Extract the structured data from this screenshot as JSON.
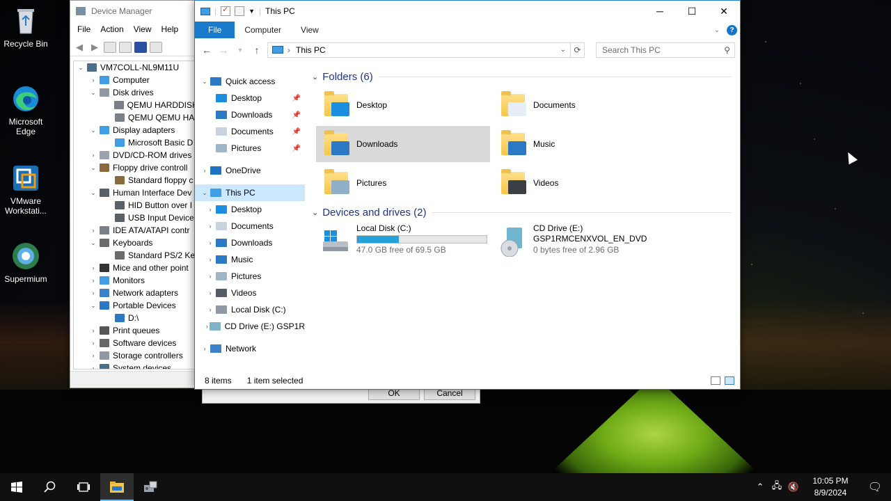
{
  "desktop": {
    "icons": [
      {
        "label": "Recycle Bin"
      },
      {
        "label": "Microsoft Edge"
      },
      {
        "label": "VMware Workstati..."
      },
      {
        "label": "Supermium"
      }
    ]
  },
  "device_manager": {
    "title": "Device Manager",
    "menu": [
      "File",
      "Action",
      "View",
      "Help"
    ],
    "tree": [
      {
        "label": "VM7COLL-NL9M11U",
        "chev": "v",
        "indent": 0
      },
      {
        "label": "Computer",
        "chev": ">",
        "indent": 1
      },
      {
        "label": "Disk drives",
        "chev": "v",
        "indent": 1
      },
      {
        "label": "QEMU HARDDISK",
        "chev": "",
        "indent": 2
      },
      {
        "label": "QEMU QEMU HA",
        "chev": "",
        "indent": 2
      },
      {
        "label": "Display adapters",
        "chev": "v",
        "indent": 1
      },
      {
        "label": "Microsoft Basic D",
        "chev": "",
        "indent": 2
      },
      {
        "label": "DVD/CD-ROM drives",
        "chev": ">",
        "indent": 1
      },
      {
        "label": "Floppy drive controll",
        "chev": "v",
        "indent": 1
      },
      {
        "label": "Standard floppy c",
        "chev": "",
        "indent": 2
      },
      {
        "label": "Human Interface Dev",
        "chev": "v",
        "indent": 1
      },
      {
        "label": "HID Button over I",
        "chev": "",
        "indent": 2
      },
      {
        "label": "USB Input Device",
        "chev": "",
        "indent": 2
      },
      {
        "label": "IDE ATA/ATAPI contr",
        "chev": ">",
        "indent": 1
      },
      {
        "label": "Keyboards",
        "chev": "v",
        "indent": 1
      },
      {
        "label": "Standard PS/2 Ke",
        "chev": "",
        "indent": 2
      },
      {
        "label": "Mice and other point",
        "chev": ">",
        "indent": 1
      },
      {
        "label": "Monitors",
        "chev": ">",
        "indent": 1
      },
      {
        "label": "Network adapters",
        "chev": ">",
        "indent": 1
      },
      {
        "label": "Portable Devices",
        "chev": "v",
        "indent": 1
      },
      {
        "label": "D:\\",
        "chev": "",
        "indent": 2
      },
      {
        "label": "Print queues",
        "chev": ">",
        "indent": 1
      },
      {
        "label": "Software devices",
        "chev": ">",
        "indent": 1
      },
      {
        "label": "Storage controllers",
        "chev": ">",
        "indent": 1
      },
      {
        "label": "System devices",
        "chev": ">",
        "indent": 1
      }
    ]
  },
  "dialog": {
    "ok_label": "OK",
    "cancel_label": "Cancel"
  },
  "explorer": {
    "title": "This PC",
    "ribbon_tabs": [
      "File",
      "Computer",
      "View"
    ],
    "help_glyph": "?",
    "address": "This PC",
    "search_placeholder": "Search This PC",
    "nav": [
      {
        "label": "Quick access",
        "chev": "v",
        "indent": 0,
        "pin": false,
        "color": "#2b78c5"
      },
      {
        "label": "Desktop",
        "chev": "",
        "indent": 1,
        "pin": true,
        "color": "#1c8ee0"
      },
      {
        "label": "Downloads",
        "chev": "",
        "indent": 1,
        "pin": true,
        "color": "#2b78c5"
      },
      {
        "label": "Documents",
        "chev": "",
        "indent": 1,
        "pin": true,
        "color": "#c9d3de"
      },
      {
        "label": "Pictures",
        "chev": "",
        "indent": 1,
        "pin": true,
        "color": "#9fb6c9"
      },
      {
        "label": "OneDrive",
        "chev": ">",
        "indent": 0,
        "pin": false,
        "color": "#1e73c2"
      },
      {
        "label": "This PC",
        "chev": "v",
        "indent": 0,
        "pin": false,
        "color": "#3f9ee6",
        "selected": true
      },
      {
        "label": "Desktop",
        "chev": ">",
        "indent": 1,
        "pin": false,
        "color": "#1c8ee0"
      },
      {
        "label": "Documents",
        "chev": ">",
        "indent": 1,
        "pin": false,
        "color": "#c9d3de"
      },
      {
        "label": "Downloads",
        "chev": ">",
        "indent": 1,
        "pin": false,
        "color": "#2b78c5"
      },
      {
        "label": "Music",
        "chev": ">",
        "indent": 1,
        "pin": false,
        "color": "#2b78c5"
      },
      {
        "label": "Pictures",
        "chev": ">",
        "indent": 1,
        "pin": false,
        "color": "#9fb6c9"
      },
      {
        "label": "Videos",
        "chev": ">",
        "indent": 1,
        "pin": false,
        "color": "#555b66"
      },
      {
        "label": "Local Disk (C:)",
        "chev": ">",
        "indent": 1,
        "pin": false,
        "color": "#8f98a3"
      },
      {
        "label": "CD Drive (E:) GSP1R",
        "chev": ">",
        "indent": 1,
        "pin": false,
        "color": "#7fb3c8"
      },
      {
        "label": "Network",
        "chev": ">",
        "indent": 0,
        "pin": false,
        "color": "#3c82c9"
      }
    ],
    "folders_header": "Folders (6)",
    "folders": [
      {
        "label": "Desktop",
        "overlay": "#1c8ee0"
      },
      {
        "label": "Documents",
        "overlay": "#e8eef5"
      },
      {
        "label": "Downloads",
        "overlay": "#2b78c5",
        "selected": true
      },
      {
        "label": "Music",
        "overlay": "#2b78c5"
      },
      {
        "label": "Pictures",
        "overlay": "#8fb0c6"
      },
      {
        "label": "Videos",
        "overlay": "#3b3f46"
      }
    ],
    "drives_header": "Devices and drives (2)",
    "drives": [
      {
        "name": "Local Disk (C:)",
        "free": "47.0 GB free of 69.5 GB",
        "used_fraction": 0.32
      },
      {
        "name": "CD Drive (E:)",
        "label": "GSP1RMCENXVOL_EN_DVD",
        "free": "0 bytes free of 2.96 GB"
      }
    ],
    "status_items": "8 items",
    "status_selected": "1 item selected"
  },
  "taskbar": {
    "time": "10:05 PM",
    "date": "8/9/2024"
  }
}
